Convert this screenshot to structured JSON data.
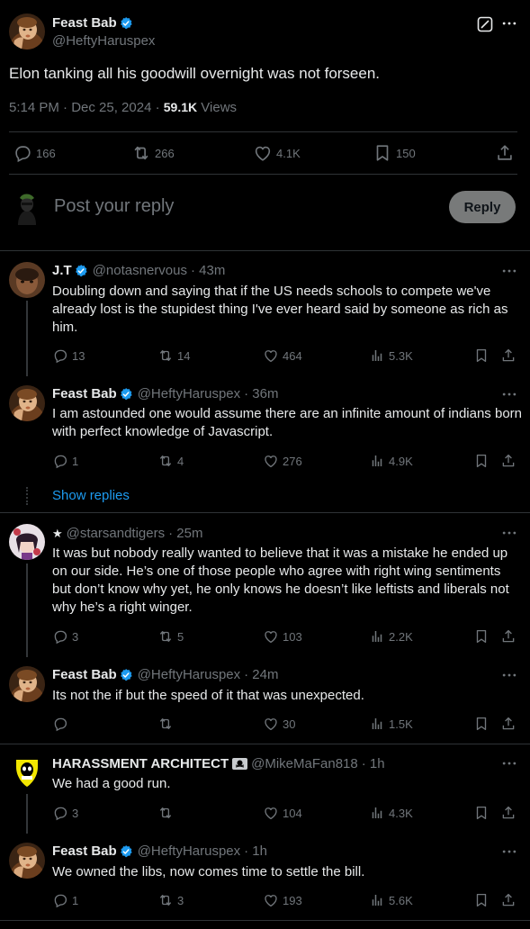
{
  "main": {
    "author_name": "Feast Bab",
    "author_handle": "@HeftyHaruspex",
    "text": "Elon tanking all his goodwill overnight was not forseen.",
    "time": "5:14 PM · Dec 25, 2024 · ",
    "views_count": "59.1K",
    "views_label": " Views",
    "replies": "166",
    "reposts": "266",
    "likes": "4.1K",
    "bookmarks": "150"
  },
  "reply_box": {
    "placeholder": "Post your reply",
    "button": "Reply"
  },
  "replies": [
    {
      "name": "J.T",
      "handle": "@notasnervous",
      "time": "· 43m",
      "text": "Doubling down and saying that if the US needs schools to compete we've already lost is the stupidest thing I've ever heard said by someone as rich as him.",
      "replies": "13",
      "reposts": "14",
      "likes": "464",
      "views": "5.3K"
    },
    {
      "name": "Feast Bab",
      "handle": "@HeftyHaruspex",
      "time": "· 36m",
      "text": "I am astounded one would assume there are an infinite amount of indians born with perfect knowledge of Javascript.",
      "replies": "1",
      "reposts": "4",
      "likes": "276",
      "views": "4.9K"
    },
    {
      "name": "",
      "name_prefix": "★",
      "handle": "@starsandtigers",
      "time": "· 25m",
      "text": "It was but nobody really wanted to believe that it was a mistake he ended up on our side. He’s one of those people who agree with right wing sentiments but don’t know why yet, he only knows he doesn’t like leftists and liberals not why he’s a right winger.",
      "replies": "3",
      "reposts": "5",
      "likes": "103",
      "views": "2.2K"
    },
    {
      "name": "Feast Bab",
      "handle": "@HeftyHaruspex",
      "time": "· 24m",
      "text": "Its not the if but the speed of it that was unexpected.",
      "replies": "",
      "reposts": "",
      "likes": "30",
      "views": "1.5K"
    },
    {
      "name": "HARASSMENT ARCHITECT",
      "handle": "@MikeMaFan818",
      "time": "· 1h",
      "text": "We had a good run.",
      "replies": "3",
      "reposts": "",
      "likes": "104",
      "views": "4.3K"
    },
    {
      "name": "Feast Bab",
      "handle": "@HeftyHaruspex",
      "time": "· 1h",
      "text": "We owned the libs, now comes time to settle the bill.",
      "replies": "1",
      "reposts": "3",
      "likes": "193",
      "views": "5.6K"
    }
  ],
  "show_replies": "Show replies",
  "colors": {
    "background": "#000000",
    "text": "#e7e9ea",
    "muted": "#71767b",
    "accent": "#1d9bf0",
    "divider": "#2f3336"
  },
  "icons": [
    "verified-badge-icon",
    "grok-icon",
    "more-icon",
    "reply-icon",
    "repost-icon",
    "like-icon",
    "bookmark-icon",
    "share-icon",
    "views-icon",
    "skull-flag-icon"
  ]
}
